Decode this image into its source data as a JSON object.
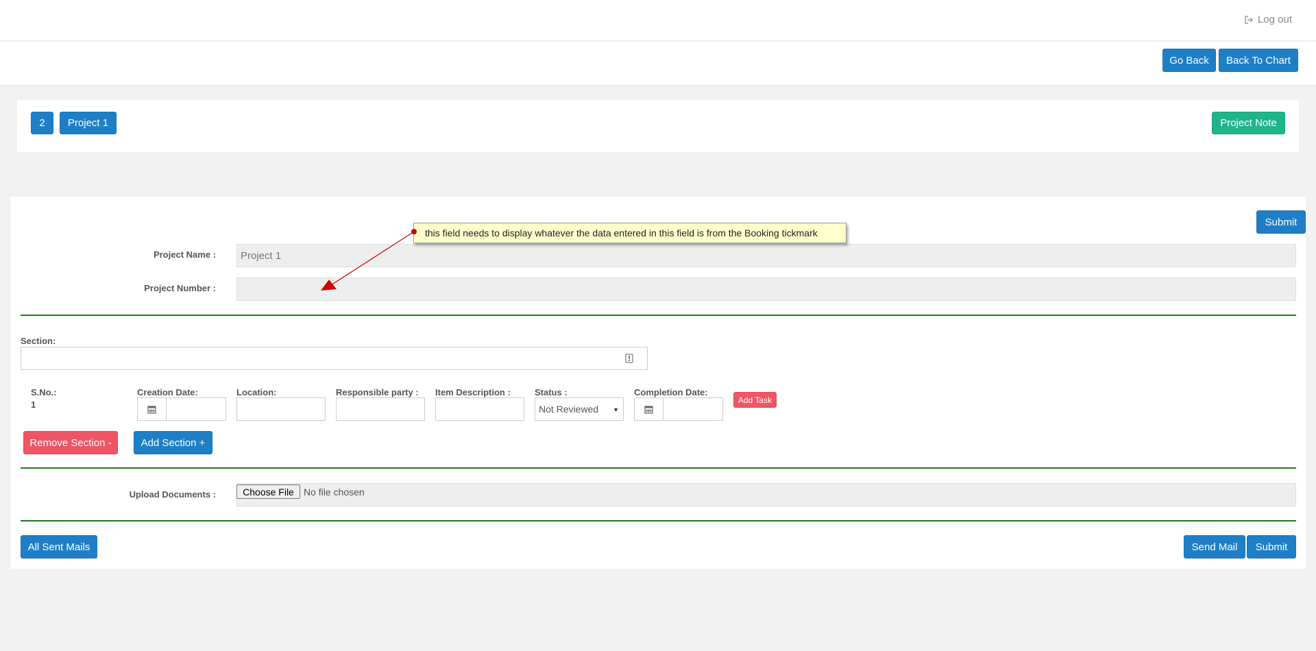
{
  "header": {
    "logout_label": "Log out"
  },
  "nav": {
    "go_back_label": "Go Back",
    "back_to_chart_label": "Back To Chart"
  },
  "project_bar": {
    "badge_number": "2",
    "project_label": "Project 1",
    "project_note_label": "Project Note"
  },
  "form": {
    "submit_top_label": "Submit",
    "callout_text": "this field needs to display whatever the data entered in this field is from the Booking tickmark",
    "project_name_label": "Project Name :",
    "project_name_value": "Project 1",
    "project_number_label": "Project Number :",
    "project_number_value": "",
    "section_label": "Section:",
    "task": {
      "sno_label": "S.No.:",
      "sno_value": "1",
      "creation_date_label": "Creation Date:",
      "location_label": "Location:",
      "responsible_label": "Responsible party :",
      "item_desc_label": "Item Description :",
      "status_label": "Status :",
      "status_value": "Not Reviewed",
      "completion_date_label": "Completion Date:",
      "add_task_label": "Add Task"
    },
    "remove_section_label": "Remove Section -",
    "add_section_label": "Add Section +",
    "upload_label": "Upload Documents :",
    "choose_file_label": "Choose File",
    "no_file_text": "No file chosen",
    "all_sent_mails_label": "All Sent Mails",
    "send_mail_label": "Send Mail",
    "submit_bottom_label": "Submit"
  },
  "colors": {
    "primary": "#1e7fc6",
    "success": "#1fb48c",
    "danger": "#ee5565",
    "divider": "#1e7a1e",
    "callout_bg": "#ffffcc",
    "arrow": "#cc0000"
  }
}
